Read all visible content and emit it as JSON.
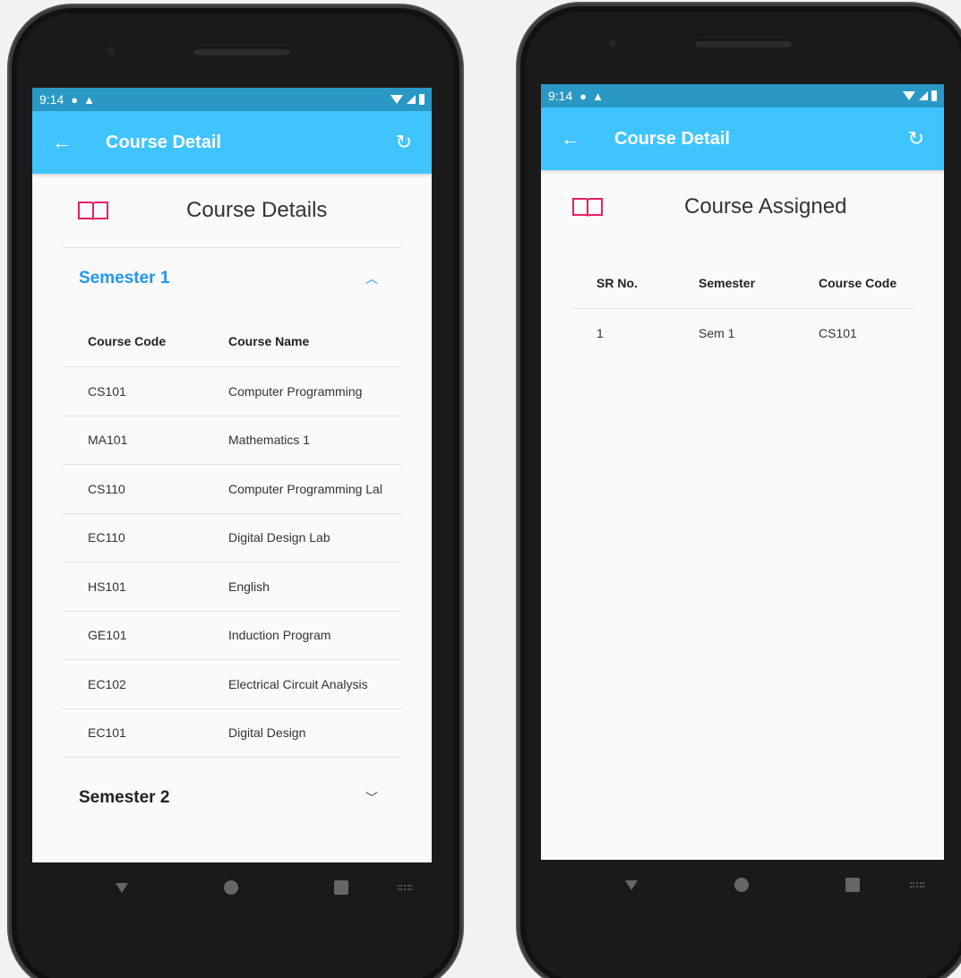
{
  "status": {
    "time": "9:14"
  },
  "left": {
    "appbar": {
      "title": "Course Detail"
    },
    "card_title": "Course Details",
    "semester1": {
      "label": "Semester 1",
      "headers": {
        "code": "Course Code",
        "name": "Course Name"
      },
      "rows": [
        {
          "code": "CS101",
          "name": "Computer Programming"
        },
        {
          "code": "MA101",
          "name": "Mathematics 1"
        },
        {
          "code": "CS110",
          "name": "Computer Programming Lal"
        },
        {
          "code": "EC110",
          "name": "Digital Design Lab"
        },
        {
          "code": "HS101",
          "name": "English"
        },
        {
          "code": "GE101",
          "name": "Induction Program"
        },
        {
          "code": "EC102",
          "name": "Electrical Circuit Analysis"
        },
        {
          "code": "EC101",
          "name": "Digital Design"
        }
      ]
    },
    "semester2": {
      "label": "Semester 2"
    }
  },
  "right": {
    "appbar": {
      "title": "Course Detail"
    },
    "card_title": "Course Assigned",
    "headers": {
      "sr": "SR No.",
      "semester": "Semester",
      "code": "Course Code"
    },
    "rows": [
      {
        "sr": "1",
        "semester": "Sem 1",
        "code": "CS101"
      }
    ]
  },
  "colors": {
    "appbar": "#40c4ff",
    "statusbar": "#2a98c5",
    "accent": "#2196f3",
    "book_icon": "#e91e63"
  },
  "icons": {
    "back": "arrow-left-icon",
    "refresh": "refresh-icon",
    "book": "book-icon"
  }
}
